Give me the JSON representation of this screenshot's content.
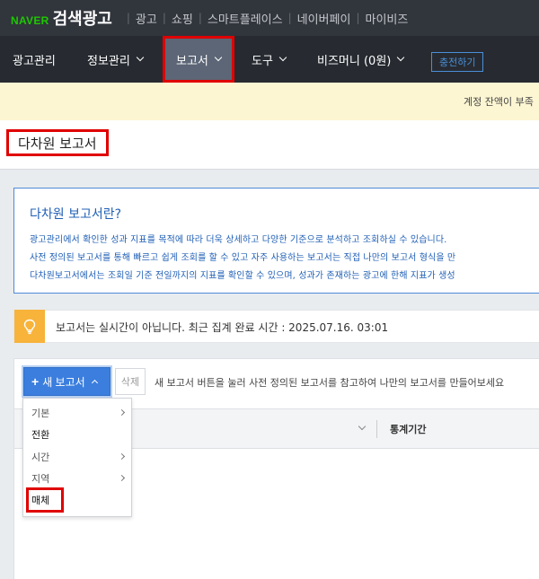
{
  "brand": {
    "naver": "NAVER",
    "title": "검색광고"
  },
  "topnav": [
    "광고",
    "쇼핑",
    "스마트플레이스",
    "네이버페이",
    "마이비즈"
  ],
  "mainnav": {
    "ad_manage": "광고관리",
    "info_manage": "정보관리",
    "report": "보고서",
    "tools": "도구",
    "bizmoney": "비즈머니 (0원)",
    "charge_button": "충전하기"
  },
  "notice": {
    "text": "계정 잔액이 부족"
  },
  "page": {
    "title": "다차원 보고서"
  },
  "info": {
    "heading": "다차원 보고서란?",
    "lines": [
      "광고관리에서 확인한 성과 지표를 목적에 따라 더욱 상세하고 다양한 기준으로 분석하고 조회하실 수 있습니다.",
      "사전 정의된 보고서를 통해 빠르고 쉽게 조회를 할 수 있고 자주 사용하는 보고서는 직접 나만의 보고서 형식을 만",
      "다차원보고서에서는 조회일 기준 전일까지의 지표를 확인할 수 있으며, 성과가 존재하는 광고에 한해 지표가 생성"
    ]
  },
  "alert": {
    "text": "보고서는 실시간이 아닙니다. 최근 집계 완료 시간 : 2025.07.16. 03:01"
  },
  "toolbar": {
    "new_report": "새 보고서",
    "delete": "삭제",
    "hint": "새 보고서 버튼을 눌러 사전 정의된 보고서를 참고하여 나만의 보고서를 만들어보세요"
  },
  "table": {
    "period_header": "통계기간"
  },
  "dropdown": {
    "items": [
      "기본",
      "전환",
      "시간",
      "지역",
      "매체"
    ]
  },
  "colors": {
    "accent": "#3b7ede",
    "highlight": "#e00000",
    "naver_green": "#1ec800"
  }
}
